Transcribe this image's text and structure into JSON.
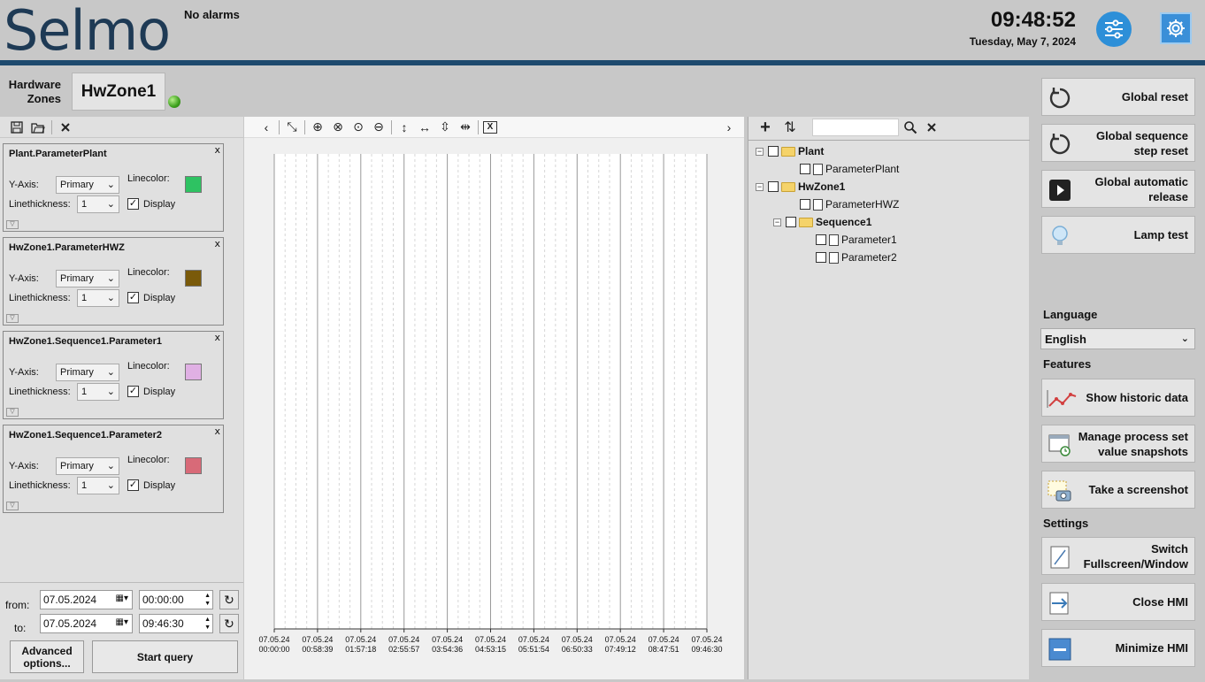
{
  "header": {
    "logo": "Selmo",
    "alarm_status": "No alarms",
    "time": "09:48:52",
    "date": "Tuesday, May 7, 2024",
    "accent_color": "#1e4a6e"
  },
  "zones": {
    "label_line1": "Hardware",
    "label_line2": "Zones",
    "zone_name": "HwZone1",
    "status_color": "#3ca01c"
  },
  "left_toolbar": [
    "save-icon",
    "open-folder-icon",
    "close-icon"
  ],
  "parameters": [
    {
      "name": "Plant.ParameterPlant",
      "yaxis_label": "Y-Axis:",
      "yaxis": "Primary",
      "linecolor_label": "Linecolor:",
      "color": "#2ec262",
      "thickness_label": "Linethickness:",
      "thickness": "1",
      "display_label": "Display",
      "display": true
    },
    {
      "name": "HwZone1.ParameterHWZ",
      "yaxis_label": "Y-Axis:",
      "yaxis": "Primary",
      "linecolor_label": "Linecolor:",
      "color": "#7a5a0a",
      "thickness_label": "Linethickness:",
      "thickness": "1",
      "display_label": "Display",
      "display": true
    },
    {
      "name": "HwZone1.Sequence1.Parameter1",
      "yaxis_label": "Y-Axis:",
      "yaxis": "Primary",
      "linecolor_label": "Linecolor:",
      "color": "#e0b0e4",
      "thickness_label": "Linethickness:",
      "thickness": "1",
      "display_label": "Display",
      "display": true
    },
    {
      "name": "HwZone1.Sequence1.Parameter2",
      "yaxis_label": "Y-Axis:",
      "yaxis": "Primary",
      "linecolor_label": "Linecolor:",
      "color": "#d86a78",
      "thickness_label": "Linethickness:",
      "thickness": "1",
      "display_label": "Display",
      "display": true
    }
  ],
  "query": {
    "from_label": "from:",
    "from_date": "07.05.2024",
    "from_time": "00:00:00",
    "to_label": "to:",
    "to_date": "07.05.2024",
    "to_time": "09:46:30",
    "advanced_label": "Advanced options...",
    "start_label": "Start query"
  },
  "chart_toolbar": [
    "chevron-left-icon",
    "autoscale-icon",
    "zoom-in-icon",
    "zoom-x-icon",
    "zoom-fit-icon",
    "zoom-out-icon",
    "vertical-arrow-icon",
    "horizontal-arrow-icon",
    "compress-vertical-icon",
    "compress-horizontal-icon",
    "excel-export-icon"
  ],
  "chart_data": {
    "type": "line",
    "series": [],
    "x_ticks": [
      {
        "date": "07.05.24",
        "time": "00:00:00"
      },
      {
        "date": "07.05.24",
        "time": "00:58:39"
      },
      {
        "date": "07.05.24",
        "time": "01:57:18"
      },
      {
        "date": "07.05.24",
        "time": "02:55:57"
      },
      {
        "date": "07.05.24",
        "time": "03:54:36"
      },
      {
        "date": "07.05.24",
        "time": "04:53:15"
      },
      {
        "date": "07.05.24",
        "time": "05:51:54"
      },
      {
        "date": "07.05.24",
        "time": "06:50:33"
      },
      {
        "date": "07.05.24",
        "time": "07:49:12"
      },
      {
        "date": "07.05.24",
        "time": "08:47:51"
      },
      {
        "date": "07.05.24",
        "time": "09:46:30"
      }
    ],
    "grid": true
  },
  "tree": {
    "nodes": [
      {
        "label": "Plant",
        "kind": "folder",
        "level": 0
      },
      {
        "label": "ParameterPlant",
        "kind": "param",
        "level": 1
      },
      {
        "label": "HwZone1",
        "kind": "folder",
        "level": 0
      },
      {
        "label": "ParameterHWZ",
        "kind": "param",
        "level": 1
      },
      {
        "label": "Sequence1",
        "kind": "folder",
        "level": 1
      },
      {
        "label": "Parameter1",
        "kind": "param",
        "level": 2
      },
      {
        "label": "Parameter2",
        "kind": "param",
        "level": 2
      }
    ]
  },
  "right": {
    "global_reset": "Global reset",
    "global_seq_reset": "Global sequence step reset",
    "global_auto_release": "Global automatic release",
    "lamp_test": "Lamp test",
    "language_heading": "Language",
    "language_value": "English",
    "features_heading": "Features",
    "show_historic": "Show historic data",
    "manage_snapshots": "Manage process set value snapshots",
    "screenshot": "Take a screenshot",
    "settings_heading": "Settings",
    "switch_fullscreen": "Switch Fullscreen/Window",
    "close_hmi": "Close HMI",
    "minimize_hmi": "Minimize HMI"
  }
}
